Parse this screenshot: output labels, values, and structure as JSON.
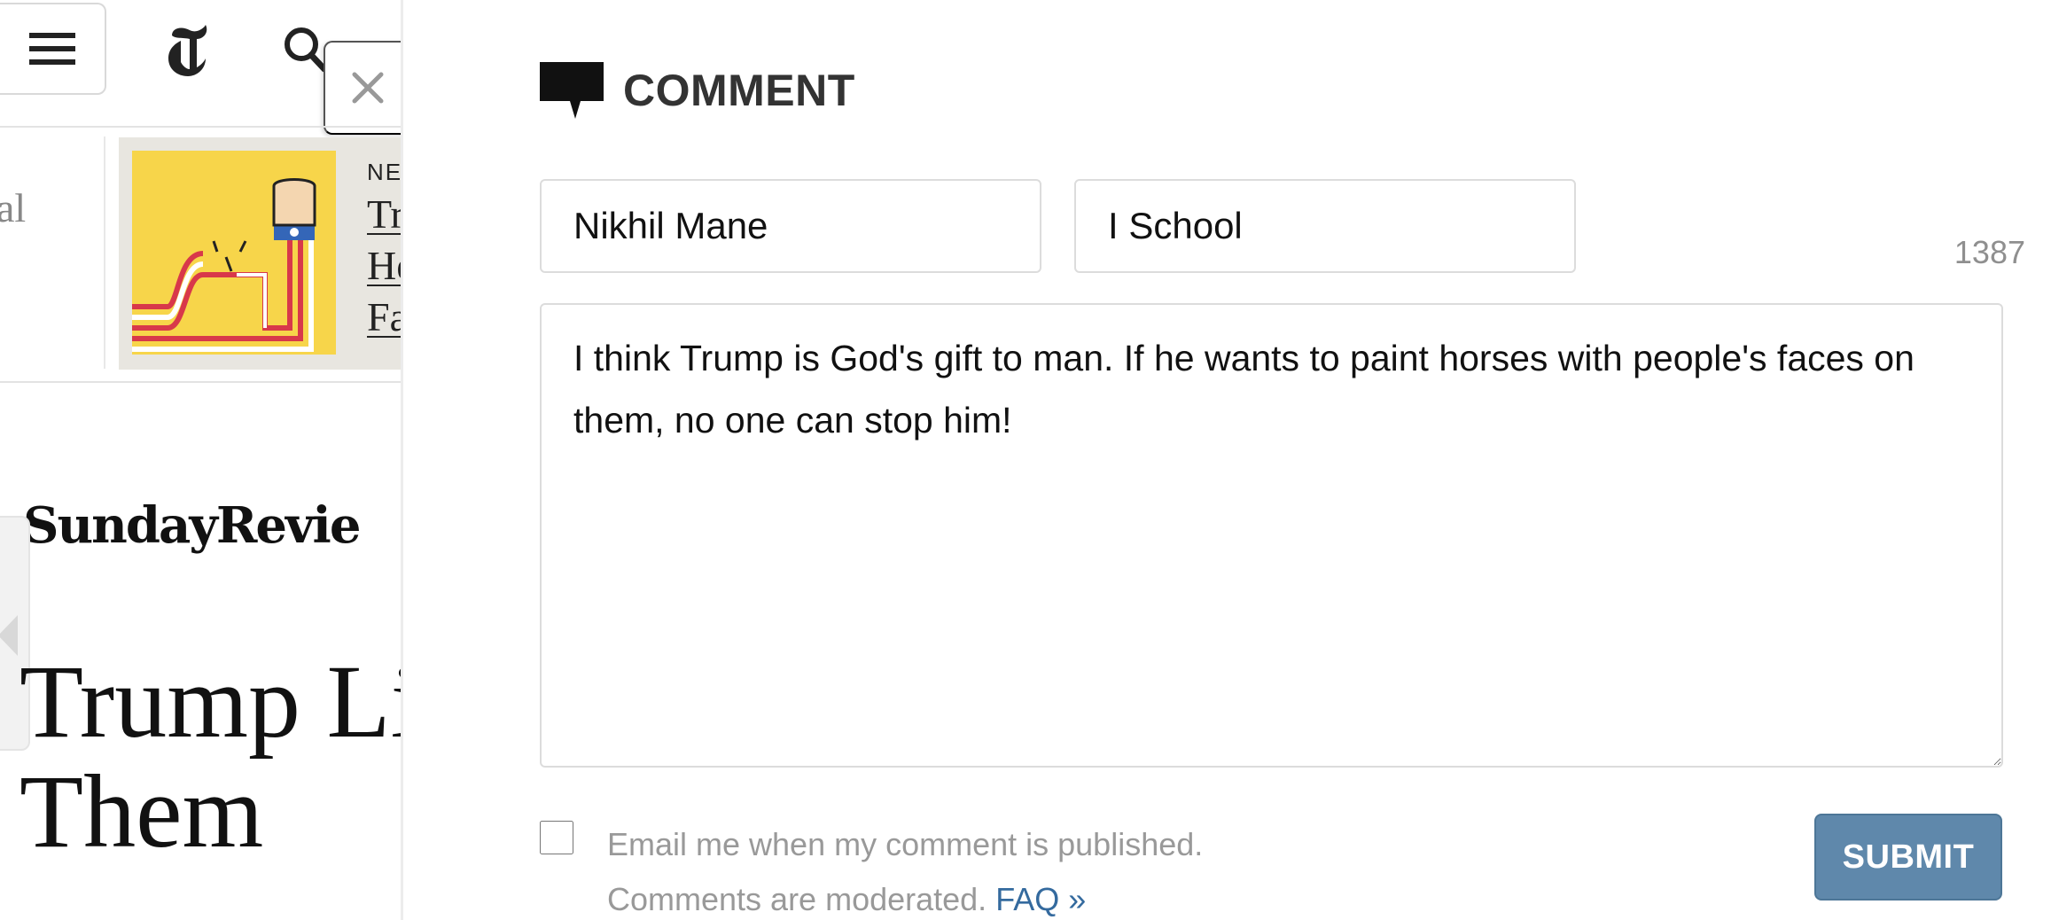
{
  "article_pane": {
    "prev_snippet": "al",
    "promo": {
      "kicker": "NE",
      "headline_lines": [
        "Tr",
        "He",
        "Fa"
      ]
    },
    "section_label": "SundayRevie",
    "article_title_lines": [
      "Trump Li",
      "Them"
    ]
  },
  "comment_form": {
    "heading": "COMMENT",
    "name_value": "Nikhil Mane",
    "location_value": "I School",
    "char_counter": "1387",
    "comment_text": "I think Trump is God's gift to man. If he wants to paint horses with people's faces on them, no one can stop him!",
    "email_checkbox_checked": false,
    "email_label": "Email me when my comment is published.",
    "moderation_note": "Comments are moderated.",
    "faq_link": "FAQ »",
    "submit_label": "SUBMIT"
  },
  "icons": {
    "menu": "hamburger-menu-icon",
    "logo": "nyt-t-logo-icon",
    "search": "search-icon",
    "close": "close-icon",
    "comment": "speech-bubble-icon",
    "prev_article": "chevron-left-icon"
  },
  "colors": {
    "submit_button": "#5f88ab",
    "faq_link": "#346a9e",
    "promo_image_bg": "#f7d54a",
    "muted_text": "#999999"
  }
}
